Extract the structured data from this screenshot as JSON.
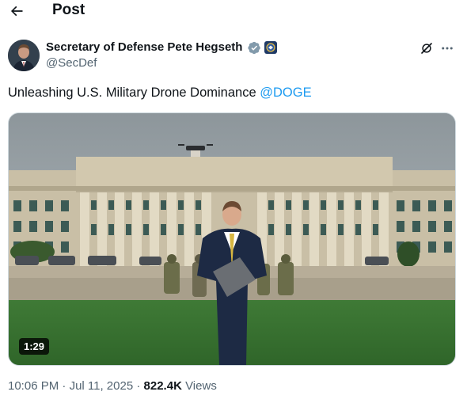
{
  "header": {
    "title": "Post",
    "back_icon": "arrow-left-icon"
  },
  "author": {
    "name": "Secretary of Defense Pete Hegseth",
    "handle": "@SecDef",
    "verified_color": "#829aab",
    "affiliation_icon": "department-of-defense-seal-icon"
  },
  "actions": {
    "grok_icon": "grok-icon",
    "more_icon": "more-horizontal-icon"
  },
  "post": {
    "text": "Unleashing U.S. Military Drone Dominance",
    "mention": "@DOGE",
    "mention_color": "#1d9bf0"
  },
  "media": {
    "type": "video",
    "duration": "1:29"
  },
  "meta": {
    "time": "10:06 PM",
    "sep1": "·",
    "date": "Jul 11, 2025",
    "sep2": "·",
    "views_count": "822.4K",
    "views_label": "Views"
  }
}
